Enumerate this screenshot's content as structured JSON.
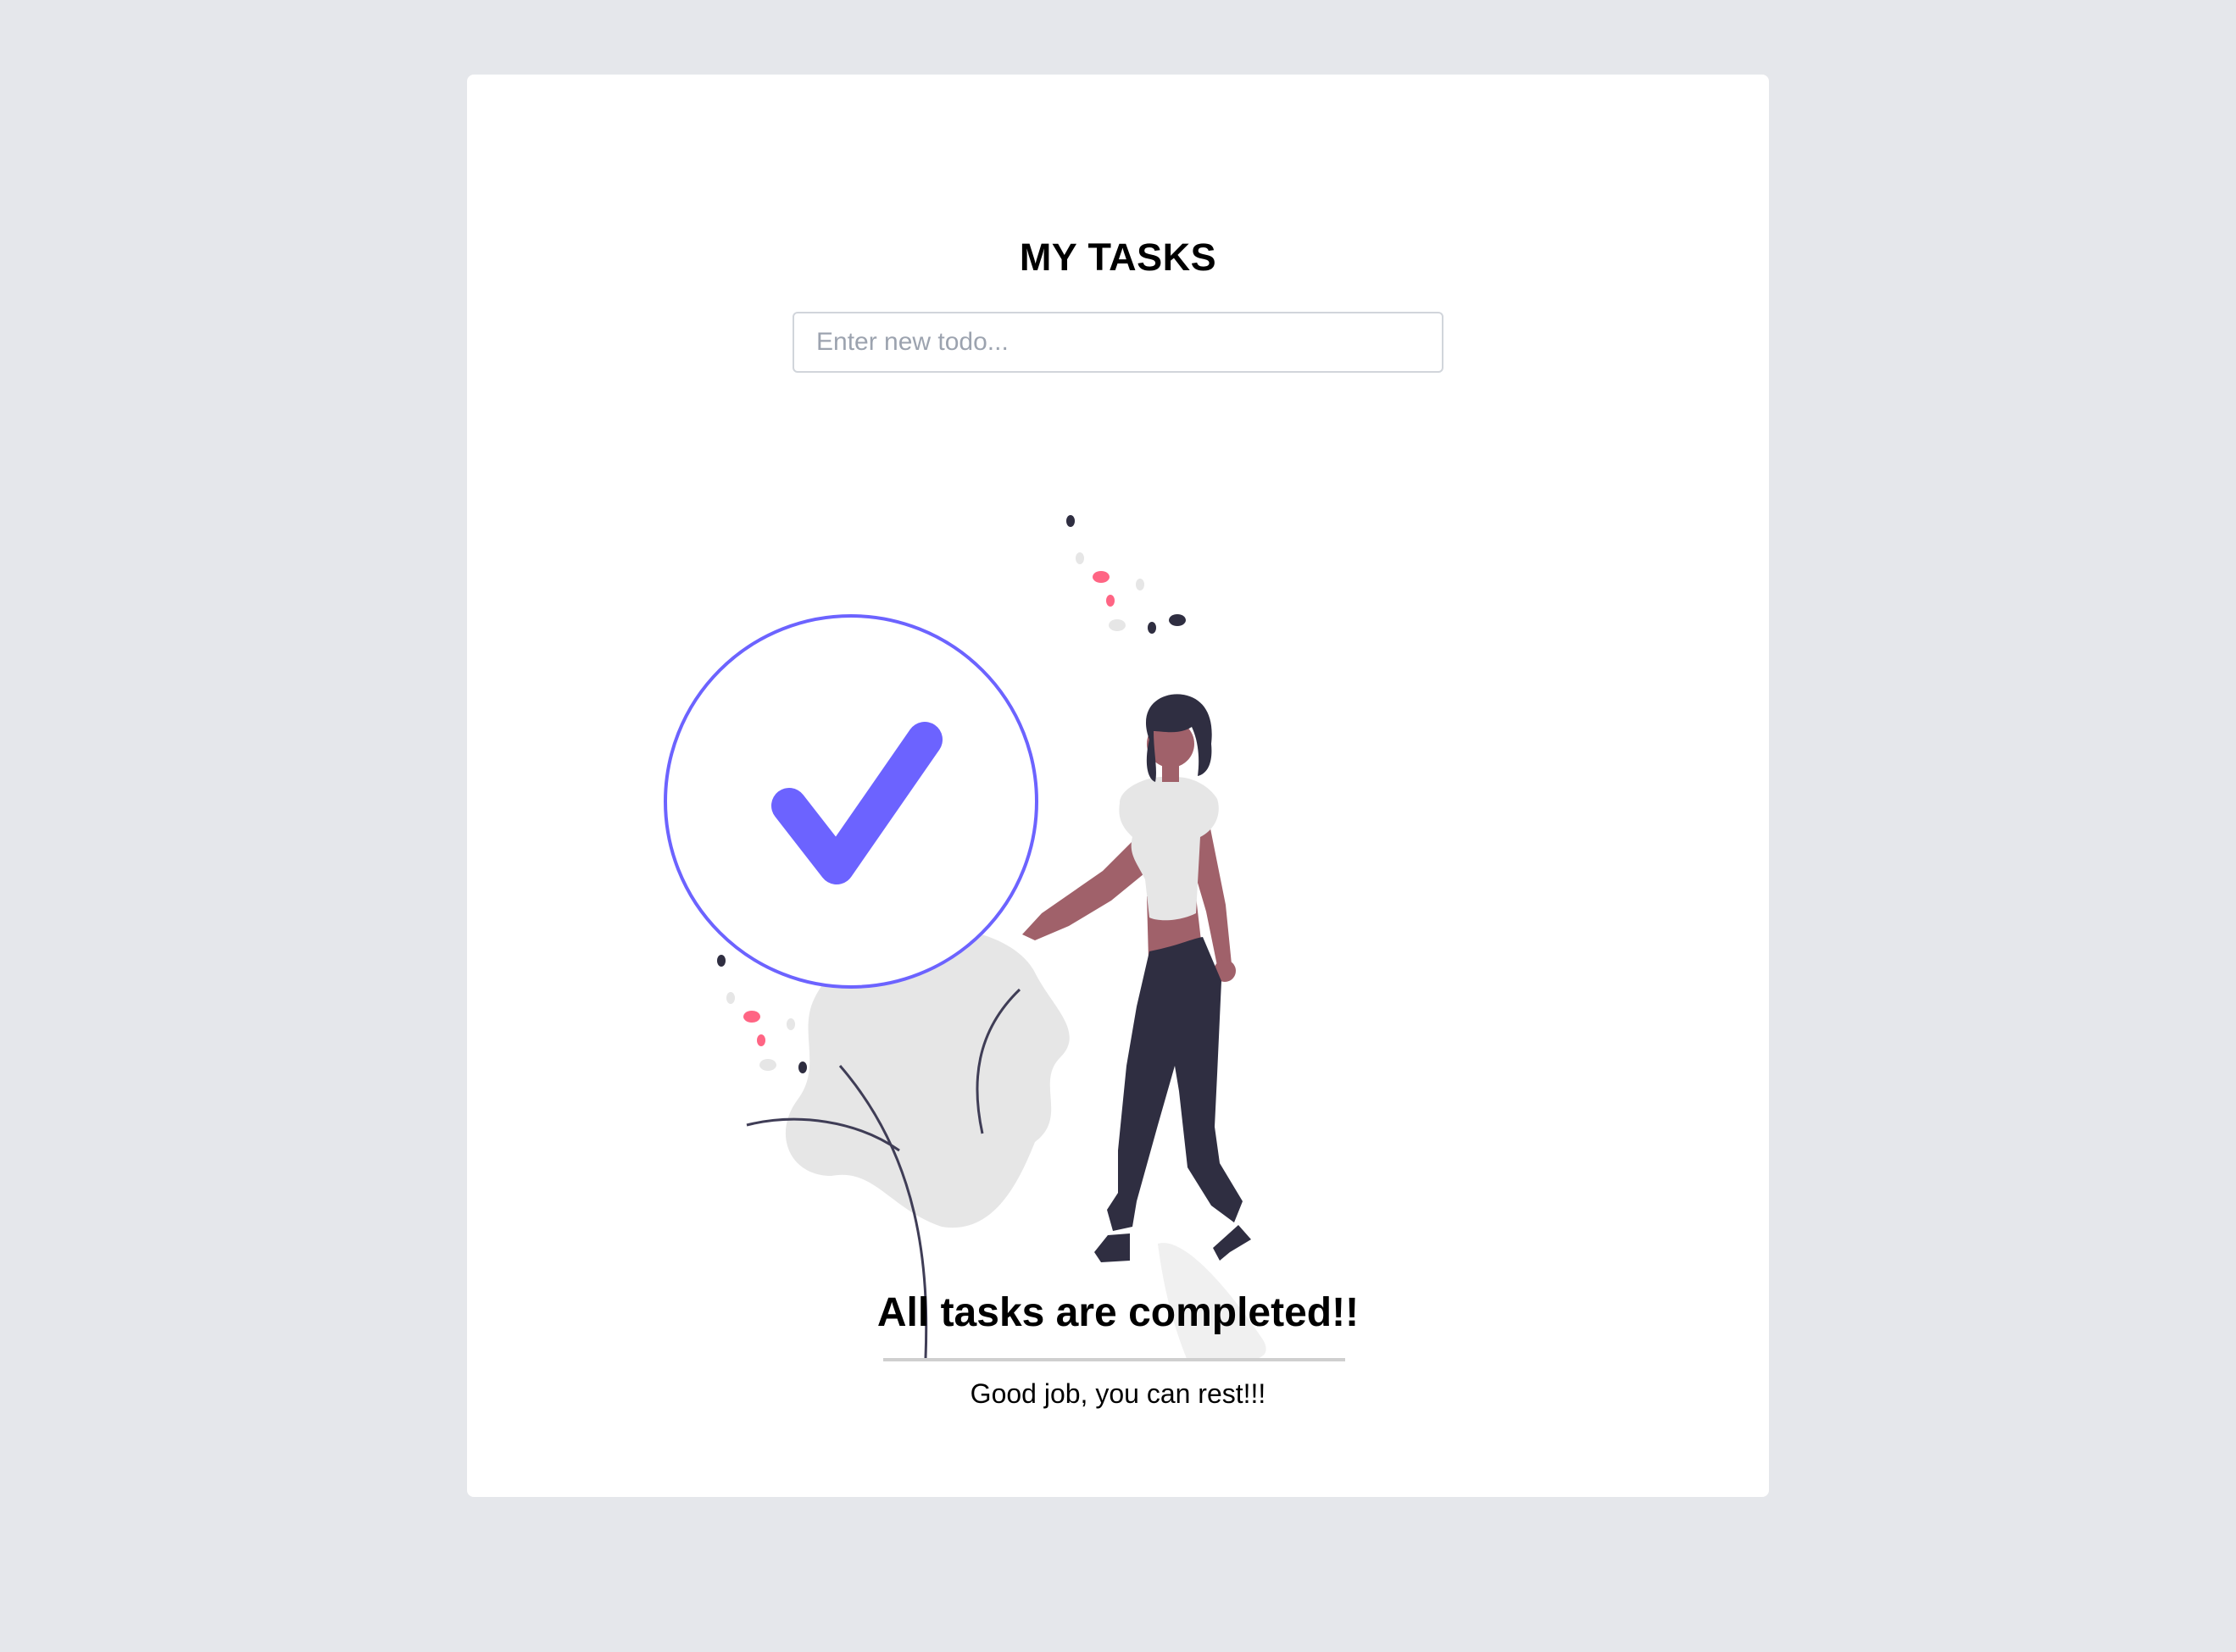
{
  "header": {
    "title": "MY TASKS"
  },
  "new_todo": {
    "placeholder": "Enter new todo...",
    "value": ""
  },
  "empty_state": {
    "illustration": "woman-with-checkmark-illustration",
    "heading": "All tasks are completed!!",
    "message": "Good job, you can rest!!!"
  },
  "colors": {
    "page_background": "#e5e7eb",
    "card_background": "#ffffff",
    "accent": "#6c63ff",
    "dark": "#2f2e41",
    "skin": "#a0616a",
    "pink": "#ff6584",
    "light_gray": "#e6e6e6"
  }
}
